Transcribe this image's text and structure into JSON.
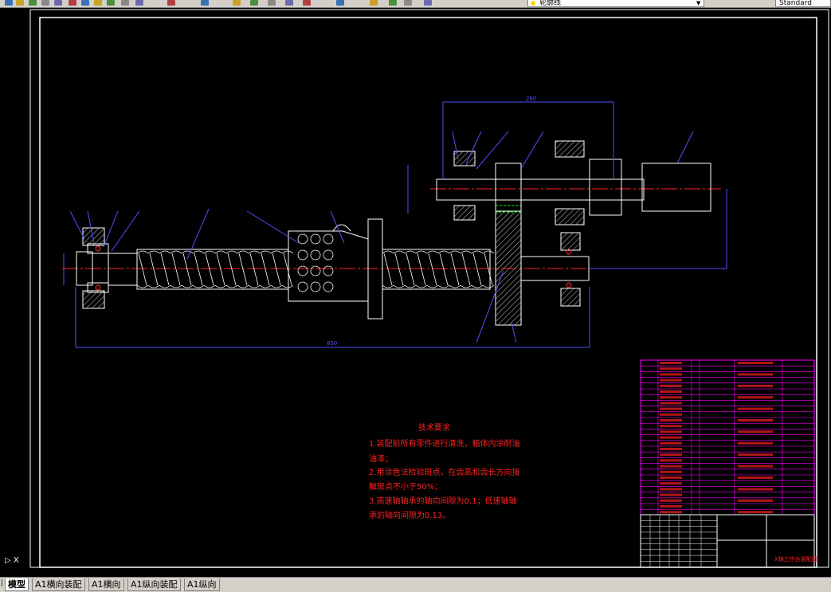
{
  "toolbar": {
    "layer_current": "轮廓线",
    "text_style": "Standard",
    "buttons": [
      "new-icon",
      "open-icon",
      "save-icon",
      "print-icon",
      "preview-icon",
      "cut-icon",
      "copy-icon",
      "paste-icon",
      "matchprop-icon",
      "undo-icon",
      "redo-icon",
      "pan-icon",
      "zoom-realtime-icon",
      "zoom-window-icon",
      "zoom-previous-icon",
      "properties-icon",
      "designcenter-icon",
      "toolpalette-icon",
      "sheetset-icon",
      "markup-icon",
      "calculator-icon",
      "help-icon",
      "layer-manager-icon"
    ]
  },
  "drawing": {
    "tech_requirements_title": "技术要求",
    "tech_requirements": [
      "1.装配前所有零件进行清洗，箱体内涂耐油",
      "油漆；",
      "2.用涂色法检验斑点，在齿高和齿长方向接",
      "触斑点不小于50%；",
      "3.高速轴轴承的轴向间隙为0.1；低速轴轴",
      "承的轴向间隙为0.13。"
    ],
    "title_block_name": "X轴工作台装配图",
    "dimension_bottom": "850",
    "dimension_top": "280"
  },
  "tabs": [
    {
      "label": "模型",
      "active": true
    },
    {
      "label": "A1横向装配",
      "active": false
    },
    {
      "label": "A1横向",
      "active": false
    },
    {
      "label": "A1纵向装配",
      "active": false
    },
    {
      "label": "A1纵向",
      "active": false
    }
  ],
  "colors": {
    "frame": "#ffffff",
    "centerline": "#ff0000",
    "outline": "#ffffff",
    "dimension": "#4040ff",
    "leader": "#4040ff",
    "table": "#ff00ff",
    "text": "#ff0000",
    "hatch": "#c0c0c0"
  }
}
